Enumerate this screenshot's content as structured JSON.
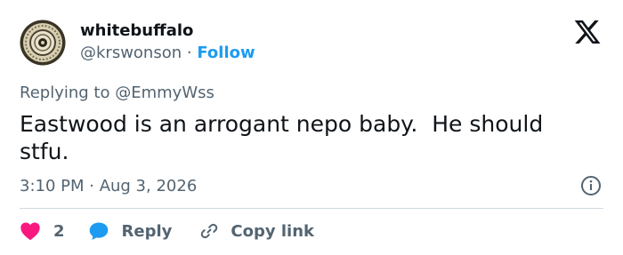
{
  "colors": {
    "text": "#0f1419",
    "muted": "#536471",
    "link": "#1d9bf0",
    "heart": "#f91880",
    "reply_bubble": "#1d9bf0",
    "divider": "#cfd9de"
  },
  "author": {
    "display_name": "whitebuffalo",
    "handle": "@krswonson",
    "separator": "·",
    "follow_label": "Follow",
    "avatar_icon": "bullseye-avatar"
  },
  "platform_icon": "x-logo-icon",
  "reply_context": {
    "prefix": "Replying to",
    "mention": "@EmmyWss"
  },
  "tweet": {
    "text": "Eastwood is an arrogant nepo baby.  He should stfu.",
    "timestamp": "3:10 PM · Aug 3, 2026"
  },
  "actions": {
    "like_count": "2",
    "reply_label": "Reply",
    "copy_label": "Copy link"
  }
}
